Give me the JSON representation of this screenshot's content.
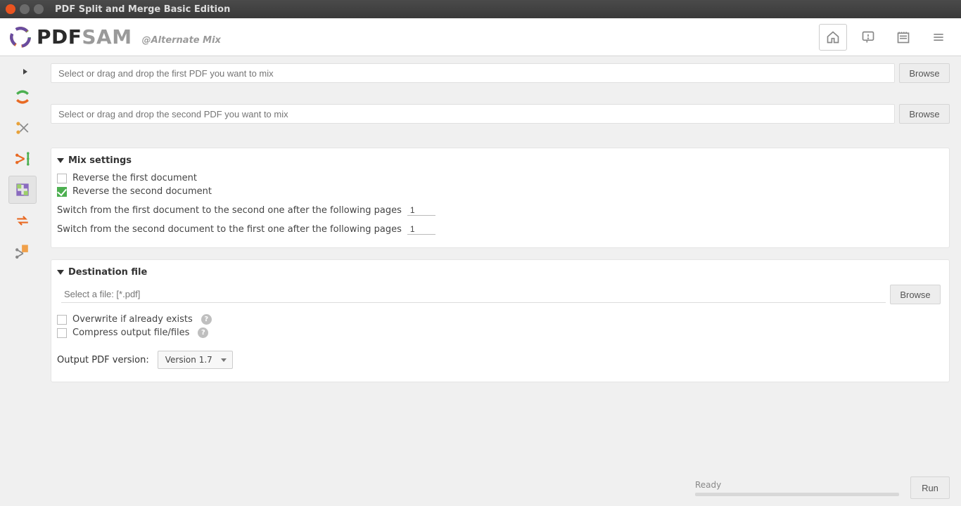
{
  "window": {
    "title": "PDF Split and Merge Basic Edition"
  },
  "header": {
    "brand_pdf": "PDF",
    "brand_sam": "SAM",
    "subtitle": "@Alternate Mix"
  },
  "files": {
    "first_placeholder": "Select or drag and drop the first PDF you want to mix",
    "second_placeholder": "Select or drag and drop the second PDF you want to mix",
    "browse": "Browse"
  },
  "mix": {
    "title": "Mix settings",
    "reverse_first": "Reverse the first document",
    "reverse_second": "Reverse the second document",
    "reverse_first_checked": false,
    "reverse_second_checked": true,
    "switch_first_label": "Switch from the first document to the second one after the following pages",
    "switch_first_value": "1",
    "switch_second_label": "Switch from the second document to the first one after the following pages",
    "switch_second_value": "1"
  },
  "dest": {
    "title": "Destination file",
    "placeholder": "Select a file: [*.pdf]",
    "browse": "Browse",
    "overwrite": "Overwrite if already exists",
    "compress": "Compress output file/files",
    "version_label": "Output PDF version:",
    "version_value": "Version 1.7"
  },
  "footer": {
    "status": "Ready",
    "run": "Run"
  }
}
